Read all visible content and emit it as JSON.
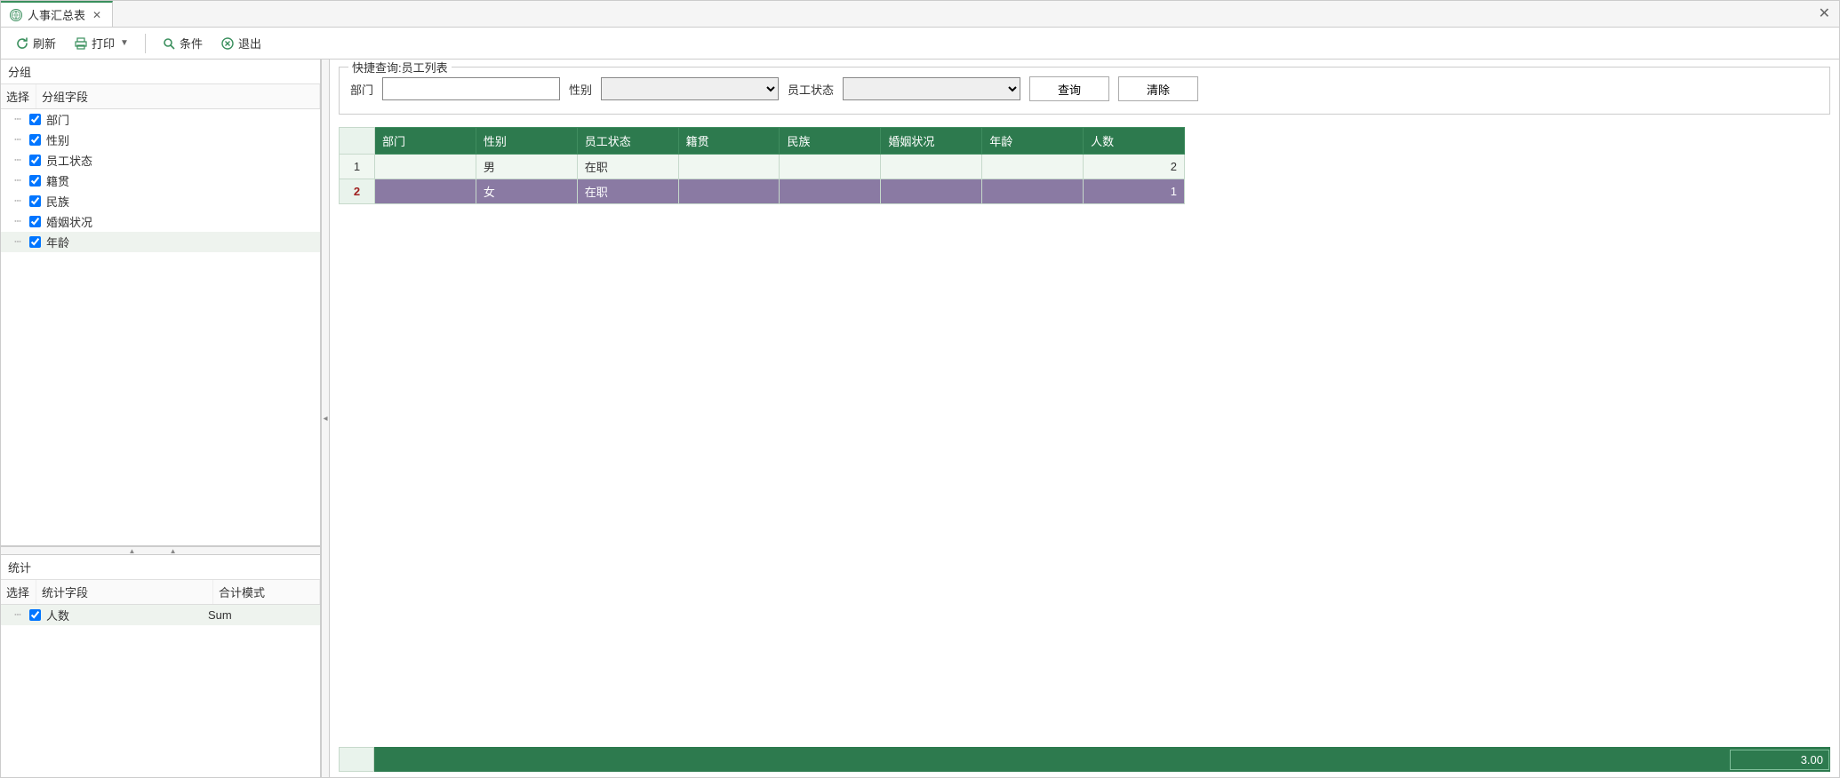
{
  "tab": {
    "title": "人事汇总表"
  },
  "toolbar": {
    "refresh": "刷新",
    "print": "打印",
    "condition": "条件",
    "exit": "退出"
  },
  "sidebar": {
    "group": {
      "title": "分组",
      "col_select": "选择",
      "col_field": "分组字段",
      "items": [
        {
          "label": "部门",
          "checked": true
        },
        {
          "label": "性别",
          "checked": true
        },
        {
          "label": "员工状态",
          "checked": true
        },
        {
          "label": "籍贯",
          "checked": true
        },
        {
          "label": "民族",
          "checked": true
        },
        {
          "label": "婚姻状况",
          "checked": true
        },
        {
          "label": "年龄",
          "checked": true
        }
      ]
    },
    "stats": {
      "title": "统计",
      "col_select": "选择",
      "col_field": "统计字段",
      "col_mode": "合计模式",
      "items": [
        {
          "label": "人数",
          "mode": "Sum",
          "checked": true
        }
      ]
    }
  },
  "query": {
    "legend": "快捷查询:员工列表",
    "dept_label": "部门",
    "dept_value": "",
    "gender_label": "性别",
    "gender_value": "",
    "status_label": "员工状态",
    "status_value": "",
    "search_btn": "查询",
    "clear_btn": "清除"
  },
  "grid": {
    "headers": [
      "部门",
      "性别",
      "员工状态",
      "籍贯",
      "民族",
      "婚姻状况",
      "年龄",
      "人数"
    ],
    "rows": [
      {
        "n": "1",
        "cells": [
          "",
          "男",
          "在职",
          "",
          "",
          "",
          "",
          "2"
        ]
      },
      {
        "n": "2",
        "cells": [
          "",
          "女",
          "在职",
          "",
          "",
          "",
          "",
          "1"
        ]
      }
    ],
    "total": "3.00"
  }
}
